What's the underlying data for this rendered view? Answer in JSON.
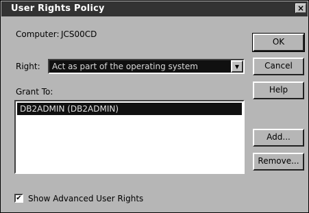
{
  "window": {
    "title": "User Rights Policy",
    "close_glyph": "×"
  },
  "computer": {
    "label": "Computer:",
    "value": "JCS00CD"
  },
  "right": {
    "label": "Right:",
    "selected": "Act as part of the operating system"
  },
  "grant": {
    "label": "Grant To:",
    "items": [
      {
        "text": "DB2ADMIN (DB2ADMIN)",
        "selected": true
      }
    ]
  },
  "buttons": {
    "ok": "OK",
    "cancel": "Cancel",
    "help": "Help",
    "add": "Add...",
    "remove": "Remove..."
  },
  "advanced": {
    "label": "Show Advanced User Rights",
    "checked": true,
    "mark": "✔"
  },
  "icons": {
    "dropdown": "chevron-down-icon",
    "close": "close-icon"
  }
}
